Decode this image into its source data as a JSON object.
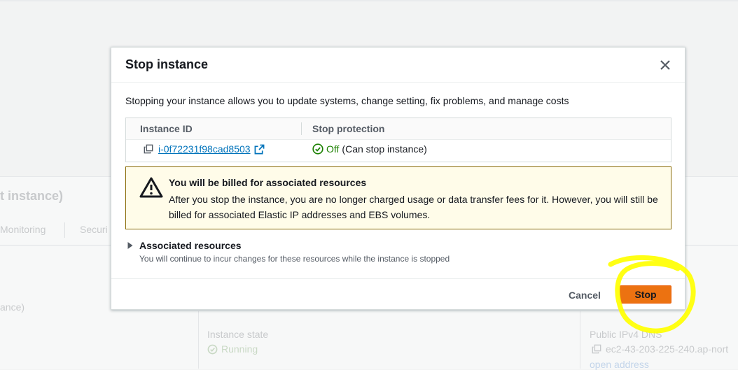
{
  "background": {
    "title_fragment": "t instance)",
    "tabs": [
      "Monitoring",
      "Securi"
    ],
    "left_text": "ance)",
    "instance_state_label": "Instance state",
    "instance_state_value": "Running",
    "dns_label": "Public IPv4 DNS",
    "dns_value": "ec2-43-203-225-240.ap-nort",
    "open_address": "open address"
  },
  "modal": {
    "title": "Stop instance",
    "description": "Stopping your instance allows you to update systems, change setting, fix problems, and manage costs",
    "table": {
      "headers": [
        "Instance ID",
        "Stop protection"
      ],
      "instance_id": "i-0f72231f98cad8503",
      "protection_status": "Off",
      "protection_detail": "(Can stop instance)"
    },
    "warning": {
      "title": "You will be billed for associated resources",
      "body": "After you stop the instance, you are no longer charged usage or data transfer fees for it. However, you will still be billed for associated Elastic IP addresses and EBS volumes."
    },
    "associated": {
      "label": "Associated resources",
      "description": "You will continue to incur changes for these resources while the instance is stopped"
    },
    "buttons": {
      "cancel": "Cancel",
      "stop": "Stop"
    }
  },
  "colors": {
    "primary_button": "#ec7211",
    "link": "#0073bb",
    "success": "#1d8102",
    "warning_border": "#8a6b05",
    "warning_bg": "#fffce9",
    "highlight_mark": "#ffff00"
  }
}
